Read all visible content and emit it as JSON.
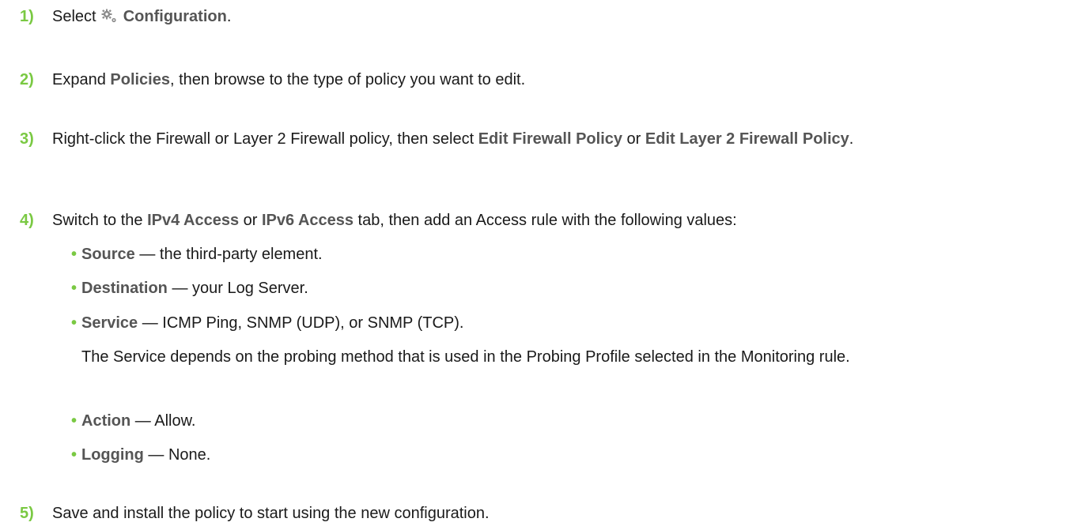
{
  "steps": [
    {
      "number": "1)",
      "text_before": "Select ",
      "icon": "gear-icon",
      "bold": "Configuration",
      "text_after": "."
    },
    {
      "number": "2)",
      "text_before": "Expand ",
      "bold": "Policies",
      "text_after": ", then browse to the type of policy you want to edit."
    },
    {
      "number": "3)",
      "text_before": "Right-click the Firewall or Layer 2 Firewall policy, then select ",
      "bold1": "Edit Firewall Policy",
      "text_mid": " or ",
      "bold2": "Edit Layer 2 Firewall Policy",
      "text_after": "."
    },
    {
      "number": "4)",
      "text_before": "Switch to the ",
      "bold1": "IPv4 Access",
      "text_mid": " or ",
      "bold2": "IPv6 Access",
      "text_after": " tab, then add an Access rule with the following values:",
      "bullets": [
        {
          "label": "Source",
          "text": " — the third-party element."
        },
        {
          "label": "Destination",
          "text": " — your Log Server."
        },
        {
          "label": "Service",
          "text": " — ICMP Ping, SNMP (UDP), or SNMP (TCP)."
        },
        {
          "label": "Action",
          "text": " — Allow."
        },
        {
          "label": "Logging",
          "text": " — None."
        }
      ],
      "note": "The Service depends on the probing method that is used in the Probing Profile selected in the Monitoring rule."
    },
    {
      "number": "5)",
      "text": "Save and install the policy to start using the new configuration."
    }
  ],
  "bullet_symbol": "•",
  "colors": {
    "accent_green": "#7ac943",
    "bold_gray": "#555555",
    "text": "#1a1a1a"
  }
}
